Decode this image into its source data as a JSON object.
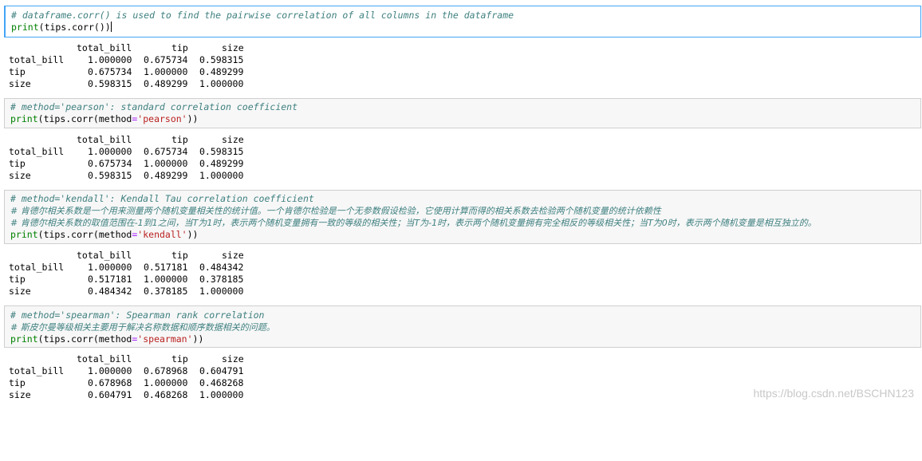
{
  "cells": [
    {
      "comment_lines": [
        "# dataframe.corr() is used to find the pairwise correlation of all columns in the dataframe"
      ],
      "code": {
        "func": "print",
        "open": "(",
        "obj": "tips.corr",
        "args_open": "(",
        "kw": "",
        "eq": "",
        "str": "",
        "args_close": ")",
        "close": ")"
      },
      "output": {
        "header": [
          "total_bill",
          "tip",
          "size"
        ],
        "rows": [
          {
            "label": "total_bill",
            "values": [
              "1.000000",
              "0.675734",
              "0.598315"
            ]
          },
          {
            "label": "tip",
            "values": [
              "0.675734",
              "1.000000",
              "0.489299"
            ]
          },
          {
            "label": "size",
            "values": [
              "0.598315",
              "0.489299",
              "1.000000"
            ]
          }
        ]
      }
    },
    {
      "comment_lines": [
        "# method='pearson': standard correlation coefficient"
      ],
      "code": {
        "func": "print",
        "open": "(",
        "obj": "tips.corr",
        "args_open": "(",
        "kw": "method",
        "eq": "=",
        "str": "'pearson'",
        "args_close": ")",
        "close": ")"
      },
      "output": {
        "header": [
          "total_bill",
          "tip",
          "size"
        ],
        "rows": [
          {
            "label": "total_bill",
            "values": [
              "1.000000",
              "0.675734",
              "0.598315"
            ]
          },
          {
            "label": "tip",
            "values": [
              "0.675734",
              "1.000000",
              "0.489299"
            ]
          },
          {
            "label": "size",
            "values": [
              "0.598315",
              "0.489299",
              "1.000000"
            ]
          }
        ]
      }
    },
    {
      "comment_lines": [
        "# method='kendall': Kendall Tau correlation coefficient",
        "# 肯德尔相关系数是一个用来测量两个随机变量相关性的统计值。一个肯德尔检验是一个无参数假设检验，它使用计算而得的相关系数去检验两个随机变量的统计依赖性",
        "# 肯德尔相关系数的取值范围在-1到1之间，当T为1时，表示两个随机变量拥有一致的等级的相关性；当T为-1时，表示两个随机变量拥有完全相反的等级相关性；当T为0时，表示两个随机变量是相互独立的。"
      ],
      "code": {
        "func": "print",
        "open": "(",
        "obj": "tips.corr",
        "args_open": "(",
        "kw": "method",
        "eq": "=",
        "str": "'kendall'",
        "args_close": ")",
        "close": ")"
      },
      "output": {
        "header": [
          "total_bill",
          "tip",
          "size"
        ],
        "rows": [
          {
            "label": "total_bill",
            "values": [
              "1.000000",
              "0.517181",
              "0.484342"
            ]
          },
          {
            "label": "tip",
            "values": [
              "0.517181",
              "1.000000",
              "0.378185"
            ]
          },
          {
            "label": "size",
            "values": [
              "0.484342",
              "0.378185",
              "1.000000"
            ]
          }
        ]
      }
    },
    {
      "comment_lines": [
        "# method='spearman': Spearman rank correlation",
        "# 斯皮尔曼等级相关主要用于解决名称数据和顺序数据相关的问题。"
      ],
      "code": {
        "func": "print",
        "open": "(",
        "obj": "tips.corr",
        "args_open": "(",
        "kw": "method",
        "eq": "=",
        "str": "'spearman'",
        "args_close": ")",
        "close": ")"
      },
      "output": {
        "header": [
          "total_bill",
          "tip",
          "size"
        ],
        "rows": [
          {
            "label": "total_bill",
            "values": [
              "1.000000",
              "0.678968",
              "0.604791"
            ]
          },
          {
            "label": "tip",
            "values": [
              "0.678968",
              "1.000000",
              "0.468268"
            ]
          },
          {
            "label": "size",
            "values": [
              "0.604791",
              "0.468268",
              "1.000000"
            ]
          }
        ]
      }
    }
  ],
  "watermark": "https://blog.csdn.net/BSCHN123",
  "colors": {
    "comment": "#408080",
    "builtin": "#008000",
    "operator": "#aa22ff",
    "string": "#ba2121",
    "active_border": "#42a5f5",
    "cell_bg": "#f7f7f7"
  }
}
